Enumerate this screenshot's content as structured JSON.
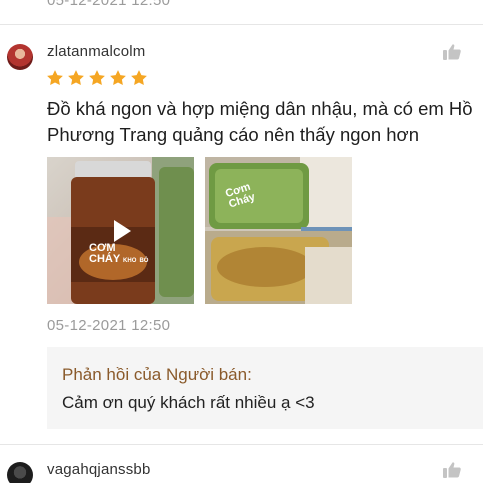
{
  "previous_review": {
    "date": "05-12-2021 12:50"
  },
  "review": {
    "username": "zlatanmalcolm",
    "rating": 5,
    "text": "Đồ khá ngon và hợp miệng dân nhậu, mà có em Hồ Phương Trang quảng cáo nên thấy ngon hơn",
    "date": "05-12-2021 12:50",
    "media": [
      {
        "type": "video",
        "icon": "play-icon",
        "label_lines": [
          "CƠM",
          "CHÁY",
          "KHO",
          "BÒ"
        ]
      },
      {
        "type": "image",
        "label_lines": [
          "Cơm",
          "Cháy"
        ]
      }
    ],
    "seller_reply": {
      "title": "Phản hồi của Người bán:",
      "text": "Cảm ơn quý khách rất nhiều ạ <3"
    }
  },
  "next_review": {
    "username": "vagahqjanssbb"
  },
  "icons": {
    "like": "thumbs-up-icon",
    "star": "star-icon",
    "play": "play-icon"
  },
  "colors": {
    "star": "#f5a623",
    "reply_title": "#8a5a2b",
    "muted": "#9b9b9b",
    "reply_bg": "#f5f5f5"
  }
}
